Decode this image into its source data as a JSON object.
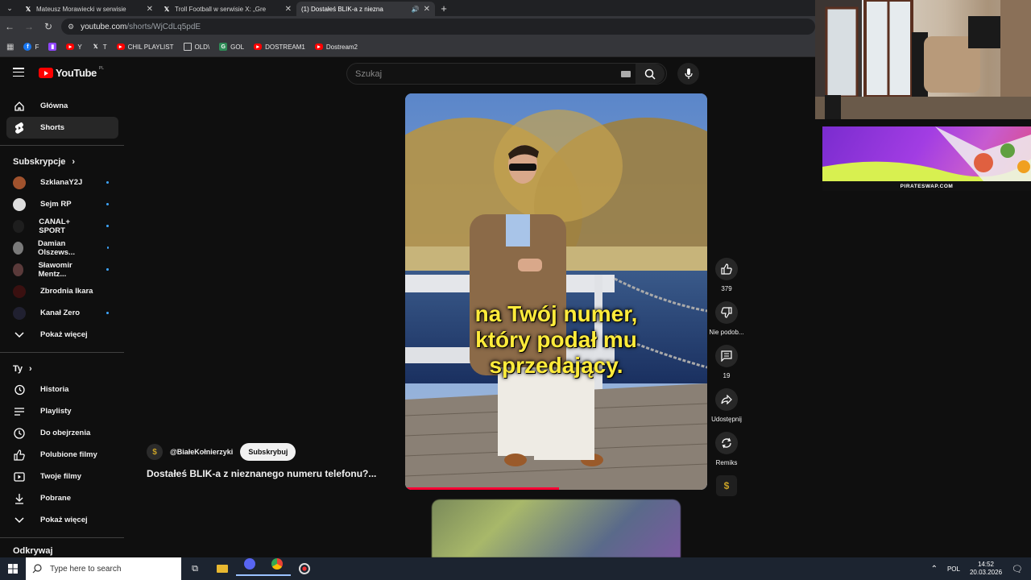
{
  "browser": {
    "tabs": [
      {
        "title": "Mateusz Morawiecki w serwisie",
        "favicon": "x-icon"
      },
      {
        "title": "Troll Football w serwisie X: „Gre",
        "favicon": "x-icon"
      },
      {
        "title": "(1) Dostałeś BLIK-a z niezna",
        "favicon": "youtube-icon"
      }
    ],
    "url_host": "youtube.com",
    "url_path": "/shorts/WjCdLq5pdE",
    "bookmarks": [
      {
        "label": "F",
        "icon": "facebook-icon"
      },
      {
        "label": "",
        "icon": "twitch-icon"
      },
      {
        "label": "Y",
        "icon": "youtube-icon"
      },
      {
        "label": "T",
        "icon": "x-icon"
      },
      {
        "label": "CHIL PLAYLIST",
        "icon": "youtube-icon"
      },
      {
        "label": "OLD\\",
        "icon": "folder-icon"
      },
      {
        "label": "GOL",
        "icon": "gol-icon"
      },
      {
        "label": "DOSTREAM1",
        "icon": "youtube-icon"
      },
      {
        "label": "Dostream2",
        "icon": "youtube-icon"
      }
    ]
  },
  "youtube": {
    "logo_text": "YouTube",
    "country_code": "PL",
    "search_placeholder": "Szukaj",
    "sidebar": {
      "main": [
        {
          "label": "Główna",
          "icon": "home-icon"
        },
        {
          "label": "Shorts",
          "icon": "shorts-icon"
        }
      ],
      "subs_header": "Subskrypcje",
      "subs": [
        {
          "label": "SzklanaY2J",
          "color": "#a0522d"
        },
        {
          "label": "Sejm RP",
          "color": "#dddddd"
        },
        {
          "label": "CANAL+ SPORT",
          "color": "#1e1e1e"
        },
        {
          "label": "Damian Olszews...",
          "color": "#7a7a7a"
        },
        {
          "label": "Sławomir Mentz...",
          "color": "#5a3a3a"
        },
        {
          "label": "Zbrodnia Ikara",
          "color": "#3a1010"
        },
        {
          "label": "Kanał Zero",
          "color": "#202030"
        }
      ],
      "subs_more": "Pokaż więcej",
      "you_header": "Ty",
      "you": [
        {
          "label": "Historia",
          "icon": "history-icon"
        },
        {
          "label": "Playlisty",
          "icon": "playlist-icon"
        },
        {
          "label": "Do obejrzenia",
          "icon": "clock-icon"
        },
        {
          "label": "Polubione filmy",
          "icon": "thumb-up-icon"
        },
        {
          "label": "Twoje filmy",
          "icon": "play-square-icon"
        },
        {
          "label": "Pobrane",
          "icon": "download-icon"
        }
      ],
      "you_more": "Pokaż więcej",
      "explore_header": "Odkrywaj"
    },
    "short": {
      "subtitle_lines": [
        "na Twój numer,",
        "który podał mu",
        "sprzedający."
      ],
      "progress": 0.51,
      "channel": "@BiałeKołnierzyki",
      "subscribe_label": "Subskrybuj",
      "title": "Dostałeś BLIK-a z nieznanego numeru telefonu?...",
      "actions": [
        {
          "label": "379",
          "icon": "thumb-up-icon"
        },
        {
          "label": "Nie podob...",
          "icon": "thumb-down-icon"
        },
        {
          "label": "19",
          "icon": "comment-icon"
        },
        {
          "label": "Udostępnij",
          "icon": "share-icon"
        },
        {
          "label": "Remiks",
          "icon": "remix-icon"
        }
      ]
    }
  },
  "overlay": {
    "ad_text": "PIRATESWAP.COM"
  },
  "taskbar": {
    "search_placeholder": "Type here to search",
    "language": "POL",
    "time": "14:52",
    "date": "20.03.2026"
  }
}
